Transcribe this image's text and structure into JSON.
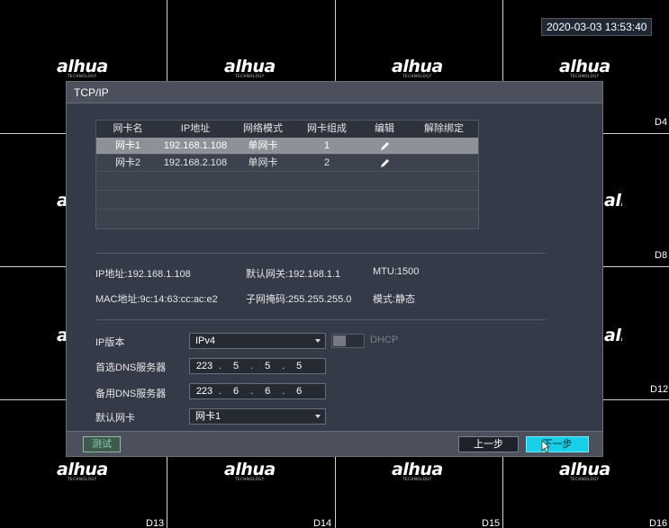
{
  "clock": "2020-03-03 13:53:40",
  "background": {
    "logo_text": "alhua",
    "logo_sub": "TECHNOLOGY",
    "channel_labels": [
      "D4",
      "D8",
      "D12",
      "D13",
      "D14",
      "D15",
      "D16"
    ]
  },
  "dialog": {
    "title": "TCP/IP",
    "table": {
      "headers": [
        "网卡名",
        "IP地址",
        "网络模式",
        "网卡组成",
        "编辑",
        "解除绑定"
      ],
      "rows": [
        {
          "name": "网卡1",
          "ip": "192.168.1.108",
          "mode": "单网卡",
          "group": "1",
          "selected": true
        },
        {
          "name": "网卡2",
          "ip": "192.168.2.108",
          "mode": "单网卡",
          "group": "2",
          "selected": false
        }
      ]
    },
    "info": {
      "ip": "IP地址:192.168.1.108",
      "gateway": "默认网关:192.168.1.1",
      "mtu": "MTU:1500",
      "mac": "MAC地址:9c:14:63:cc:ac:e2",
      "mask": "子网掩码:255.255.255.0",
      "mode": "模式:静态"
    },
    "form": {
      "ip_version_label": "IP版本",
      "ip_version_value": "IPv4",
      "dhcp_label": "DHCP",
      "dns1_label": "首选DNS服务器",
      "dns1": [
        "223",
        "5",
        "5",
        "5"
      ],
      "dns2_label": "备用DNS服务器",
      "dns2": [
        "223",
        "6",
        "6",
        "6"
      ],
      "default_nic_label": "默认网卡",
      "default_nic_value": "网卡1"
    },
    "footer": {
      "test_label": "测试",
      "prev_label": "上一步",
      "next_label": "下一步"
    }
  }
}
